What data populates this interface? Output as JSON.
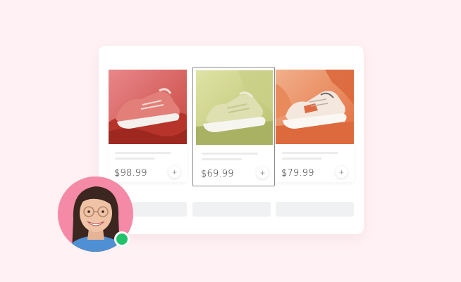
{
  "products": [
    {
      "price": "$98.99",
      "add_symbol": "+",
      "image": "pink-sneaker-photo"
    },
    {
      "price": "$69.99",
      "add_symbol": "+",
      "image": "green-sneaker-photo"
    },
    {
      "price": "$79.99",
      "add_symbol": "+",
      "image": "orange-sneaker-photo"
    }
  ],
  "user": {
    "avatar": "woman-with-glasses-photo",
    "status": "online",
    "status_color": "#22c26a"
  },
  "colors": {
    "background": "#fff1f4",
    "panel": "#ffffff",
    "selected_border": "#8e8e8e",
    "avatar_bg": "#f48aa6"
  }
}
